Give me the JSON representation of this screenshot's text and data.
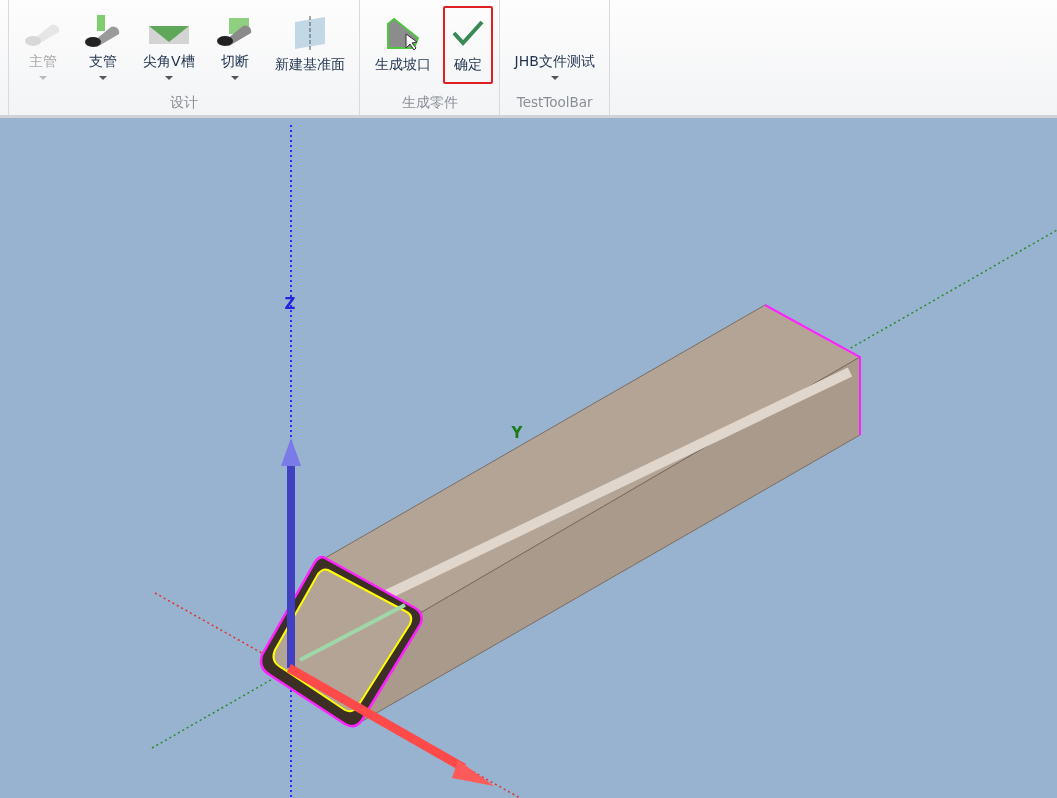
{
  "ribbon": {
    "groups": [
      {
        "label": "设计",
        "buttons": [
          {
            "label": "主管",
            "disabled": true,
            "dropdown": true,
            "highlighted": false
          },
          {
            "label": "支管",
            "disabled": false,
            "dropdown": true,
            "highlighted": false
          },
          {
            "label": "尖角V槽",
            "disabled": false,
            "dropdown": true,
            "highlighted": false
          },
          {
            "label": "切断",
            "disabled": false,
            "dropdown": true,
            "highlighted": false
          },
          {
            "label": "新建基准面",
            "disabled": false,
            "dropdown": false,
            "highlighted": false
          }
        ]
      },
      {
        "label": "生成零件",
        "buttons": [
          {
            "label": "生成坡口",
            "disabled": false,
            "dropdown": false,
            "highlighted": false
          },
          {
            "label": "确定",
            "disabled": false,
            "dropdown": false,
            "highlighted": true
          }
        ]
      },
      {
        "label": "TestToolBar",
        "buttons": [
          {
            "label": "JHB文件测试",
            "disabled": false,
            "dropdown": true,
            "highlighted": false
          }
        ]
      }
    ]
  },
  "viewport": {
    "axis_labels": [
      "Z",
      "Y"
    ]
  }
}
